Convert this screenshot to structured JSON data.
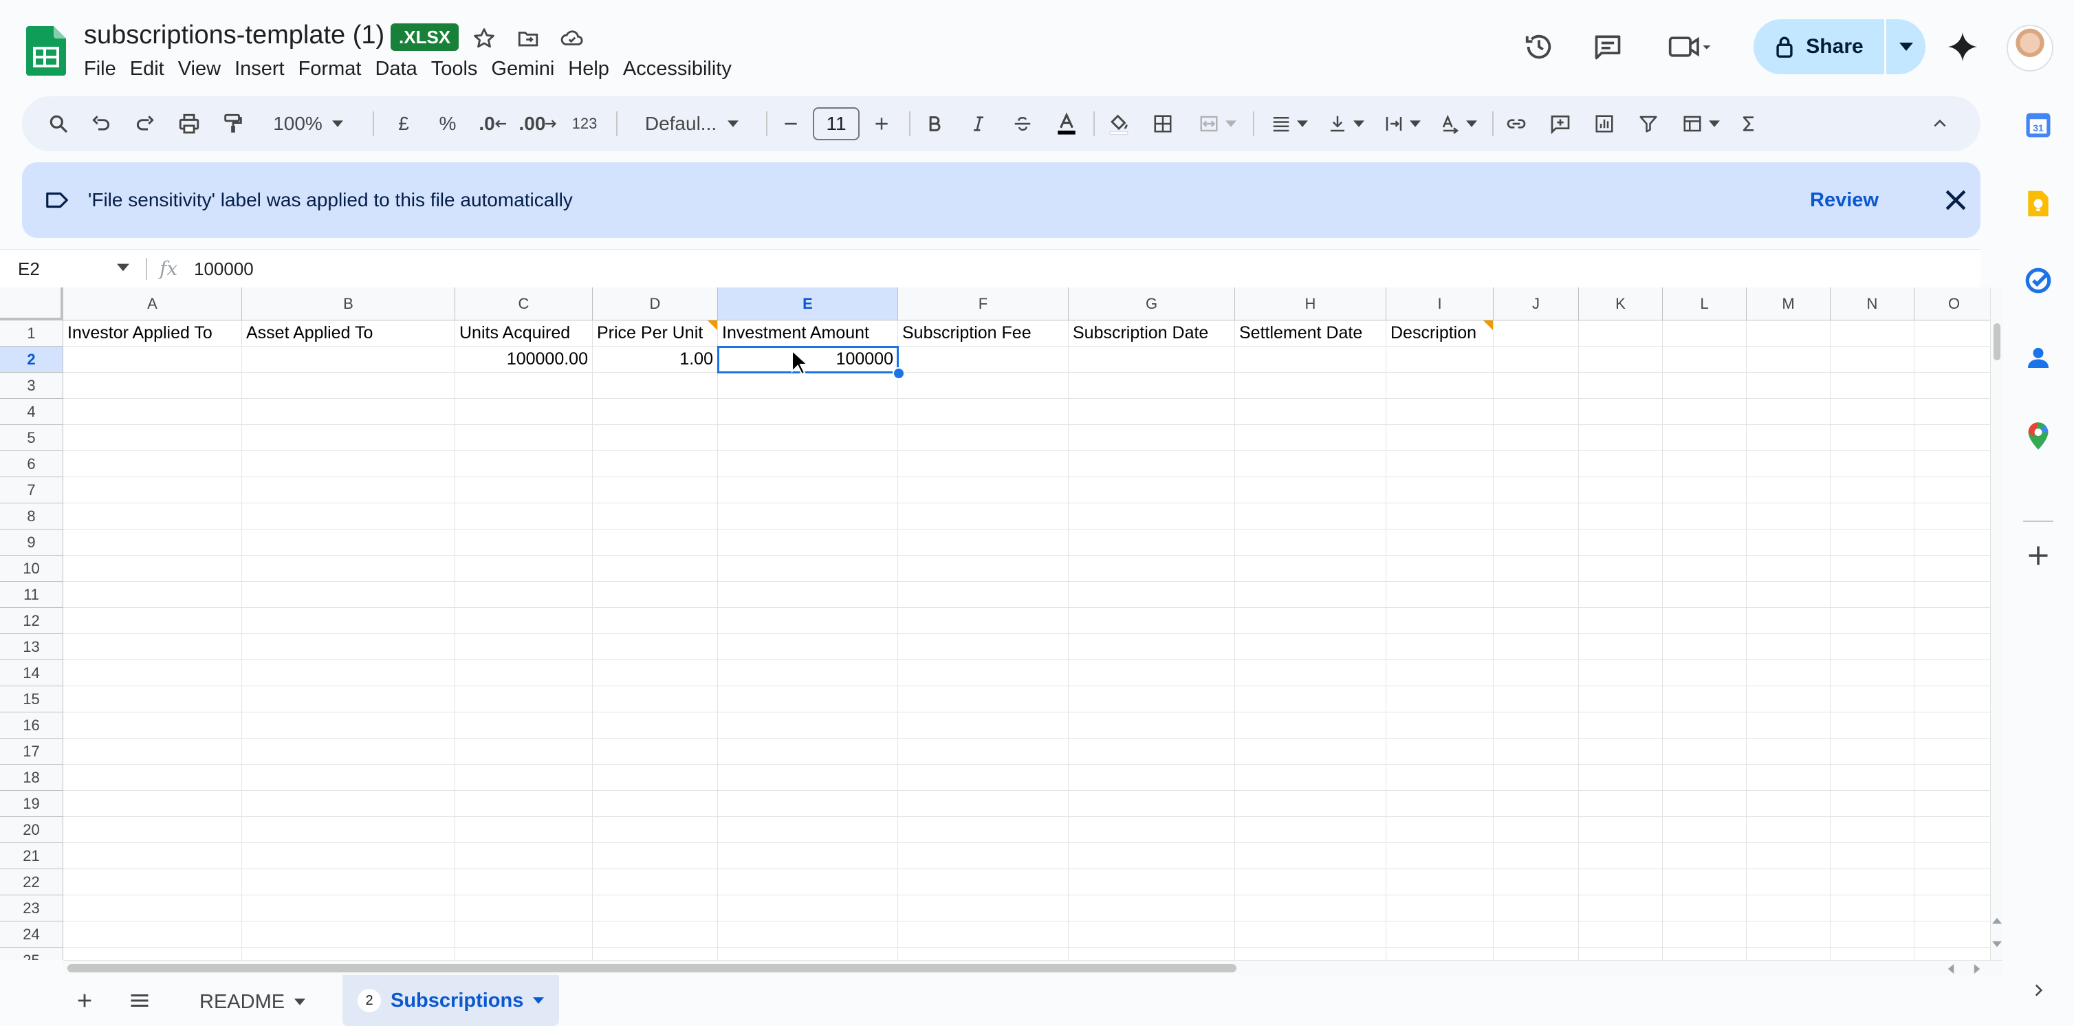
{
  "header": {
    "title": "subscriptions-template (1)",
    "file_badge": ".XLSX",
    "menu": [
      "File",
      "Edit",
      "View",
      "Insert",
      "Format",
      "Data",
      "Tools",
      "Gemini",
      "Help",
      "Accessibility"
    ],
    "share_label": "Share"
  },
  "toolbar": {
    "zoom": "100%",
    "currency": "£",
    "percent": "%",
    "decrease_decimal": ".0",
    "increase_decimal": ".00",
    "number_format": "123",
    "font": "Defaul...",
    "font_size": "11"
  },
  "banner": {
    "message": "'File sensitivity' label was applied to this file automatically",
    "review": "Review"
  },
  "formula_bar": {
    "cell_ref": "E2",
    "fx": "fx",
    "value": "100000"
  },
  "grid": {
    "columns": [
      "A",
      "B",
      "C",
      "D",
      "E",
      "F",
      "G",
      "H",
      "I",
      "J",
      "K",
      "L",
      "M",
      "N",
      "O"
    ],
    "rows": [
      "1",
      "2",
      "3",
      "4",
      "5",
      "6",
      "7",
      "8",
      "9",
      "10",
      "11",
      "12",
      "13",
      "14",
      "15",
      "16",
      "17",
      "18",
      "19",
      "20",
      "21",
      "22",
      "23",
      "24",
      "25"
    ],
    "selected_column": "E",
    "selected_row": "2",
    "header_row": [
      "Investor Applied To",
      "Asset Applied To",
      "Units Acquired",
      "Price Per Unit",
      "Investment Amount",
      "Subscription Fee",
      "Subscription Date",
      "Settlement Date",
      "Description"
    ],
    "data_row": [
      "",
      "",
      "100000.00",
      "1.00",
      "100000",
      "",
      "",
      "",
      ""
    ]
  },
  "sheets": {
    "readme": "README",
    "subscriptions": "Subscriptions",
    "subscriptions_badge": "2"
  },
  "colors": {
    "accent": "#0b57d0",
    "brand_green": "#188038",
    "banner_bg": "#d3e3fd",
    "selection": "#1a73e8"
  },
  "side_panel_icons": [
    "calendar-icon",
    "keep-icon",
    "tasks-icon",
    "contacts-icon",
    "maps-icon",
    "add-icon"
  ]
}
